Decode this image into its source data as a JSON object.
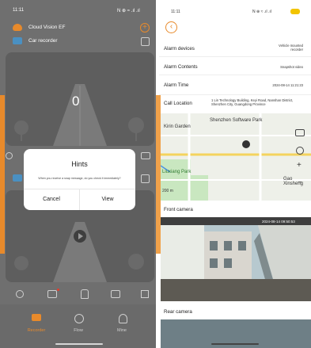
{
  "left": {
    "status": {
      "time": "11:11",
      "icons": "N ⊕ ≈ .ıl .ıl"
    },
    "devices": [
      {
        "name": "Cloud Vision EF"
      },
      {
        "name": "Car recorder"
      }
    ],
    "video_value": "0",
    "dialog": {
      "title": "Hints",
      "message": "When you receive a snap message, do you check it immediately?",
      "cancel": "Cancel",
      "view": "View"
    },
    "nav": {
      "recorder": "Recorder",
      "flow": "Flow",
      "mine": "Mine"
    }
  },
  "right": {
    "status": {
      "time": "11:11",
      "icons": "N ⊕ ≈ .ıl .ıl"
    },
    "rows": {
      "alarm_devices_label": "Alarm devices",
      "alarm_devices_value": "Vehicle mounted recorder",
      "alarm_contents_label": "Alarm Contents",
      "alarm_contents_value": "Snapshot video",
      "alarm_time_label": "Alarm Time",
      "alarm_time_value": "2024-08-14 11:21:23",
      "call_location_label": "Call Location",
      "call_location_value": "1 Lin Technology Building, Keyi Road, Nanshan District, Shenzhen City, Guangdong Province"
    },
    "map": {
      "place1": "Shenzhen Software Park",
      "place2": "Kirin Garden",
      "place3": "Liuxiang Park",
      "place4": "Gao Xinsheng",
      "scale": "200 m"
    },
    "front_camera": "Front camera",
    "front_timestamp": "2024-08-14 09:50:53",
    "rear_camera": "Rear camera"
  },
  "colors": {
    "accent": "#e88a2b",
    "dark_bg": "#6f6f6f"
  }
}
